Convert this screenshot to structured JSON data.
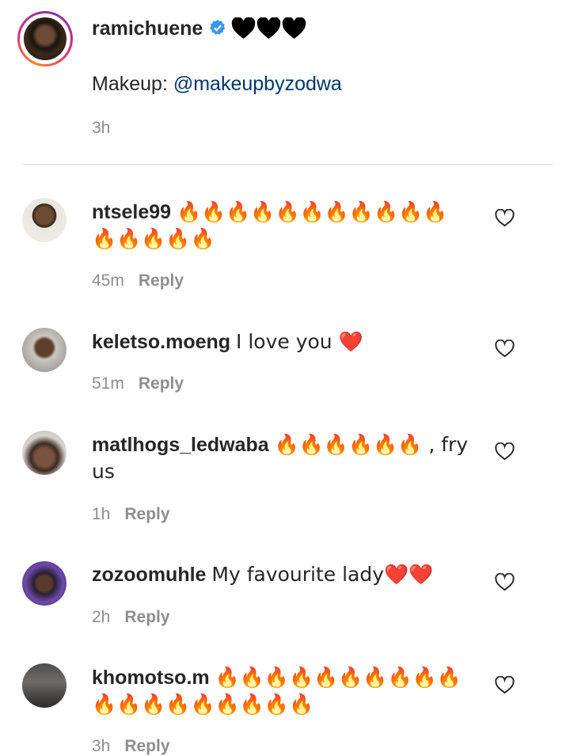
{
  "caption": {
    "username": "ramichuene",
    "username_emoji": "🖤🖤🖤",
    "text_prefix": "Makeup: ",
    "mention": "@makeupbyzodwa",
    "time": "3h",
    "verified_icon": "verified-badge-icon",
    "heart_icon": "black-heart-icon"
  },
  "comments": [
    {
      "username": "ntsele99",
      "text": "🔥🔥🔥🔥🔥🔥🔥🔥🔥🔥🔥🔥🔥🔥🔥🔥",
      "time": "45m",
      "reply": "Reply"
    },
    {
      "username": "keletso.moeng",
      "text": "I love you ❤️",
      "time": "51m",
      "reply": "Reply"
    },
    {
      "username": "matlhogs_ledwaba",
      "text": "🔥🔥🔥🔥🔥🔥 , fry us",
      "time": "1h",
      "reply": "Reply"
    },
    {
      "username": "zozoomuhle",
      "text": "My favourite lady❤️❤️",
      "time": "2h",
      "reply": "Reply"
    },
    {
      "username": "khomotso.m",
      "text": "🔥🔥🔥🔥🔥🔥🔥🔥🔥🔥🔥🔥🔥🔥🔥🔥🔥🔥🔥",
      "time": "3h",
      "reply": "Reply"
    }
  ],
  "icons": {
    "like": "heart-outline-icon"
  },
  "colors": {
    "mention": "#00376b",
    "meta": "#8e8e8e",
    "verified": "#3897f0",
    "fire": "#ff5a1f",
    "red_heart": "#e0245e"
  }
}
